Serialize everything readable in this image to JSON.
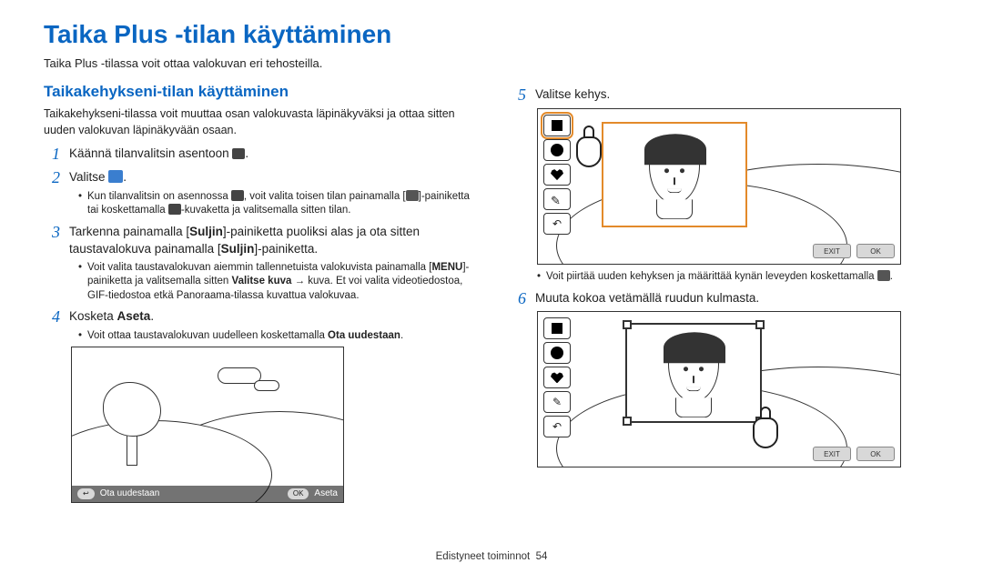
{
  "page": {
    "title": "Taika Plus -tilan käyttäminen",
    "intro": "Taika Plus -tilassa voit ottaa valokuvan eri tehosteilla."
  },
  "left": {
    "subhead": "Taikakehykseni-tilan käyttäminen",
    "subintro": "Taikakehykseni-tilassa voit muuttaa osan valokuvasta läpinäkyväksi ja ottaa sitten uuden valokuvan läpinäkyvään osaan.",
    "step1_pre": "Käännä tilanvalitsin asentoon ",
    "step1_post": ".",
    "step2_pre": "Valitse ",
    "step2_post": ".",
    "bullet2a_pre": "Kun tilanvalitsin on asennossa ",
    "bullet2a_mid": ", voit valita toisen tilan painamalla [",
    "bullet2a_mid2": "]-painiketta tai koskettamalla ",
    "bullet2a_post": "-kuvaketta ja valitsemalla sitten tilan.",
    "step3_a": "Tarkenna painamalla [",
    "step3_b": "Suljin",
    "step3_c": "]-painiketta puoliksi alas ja ota sitten taustavalokuva painamalla [",
    "step3_d": "]-painiketta.",
    "bullet3a_a": "Voit valita taustavalokuvan aiemmin tallennetuista valokuvista painamalla [",
    "bullet3a_menu": "MENU",
    "bullet3a_b": "]-painiketta ja valitsemalla sitten ",
    "bullet3a_sel": "Valitse kuva",
    "bullet3a_c": " → kuva. Et voi valita videotiedostoa, GIF-tiedostoa etkä Panoraama-tilassa kuvattua valokuvaa.",
    "step4_a": "Kosketa ",
    "step4_b": "Aseta",
    "step4_c": ".",
    "bullet4a_a": "Voit ottaa taustavalokuvan uudelleen koskettamalla ",
    "bullet4a_b": "Ota uudestaan",
    "bullet4a_c": "."
  },
  "right": {
    "step5": "Valitse kehys.",
    "bullet5_a": "Voit piirtää uuden kehyksen ja määrittää kynän leveyden koskettamalla ",
    "bullet5_b": ".",
    "step6": "Muuta kokoa vetämällä ruudun kulmasta."
  },
  "bottombar": {
    "retake_label": "Ota uudestaan",
    "ok_label": "OK",
    "set_label": "Aseta"
  },
  "exitbar": {
    "exit": "EXIT",
    "ok": "OK"
  },
  "footer": {
    "section": "Edistyneet toiminnot",
    "page_num": "54"
  }
}
